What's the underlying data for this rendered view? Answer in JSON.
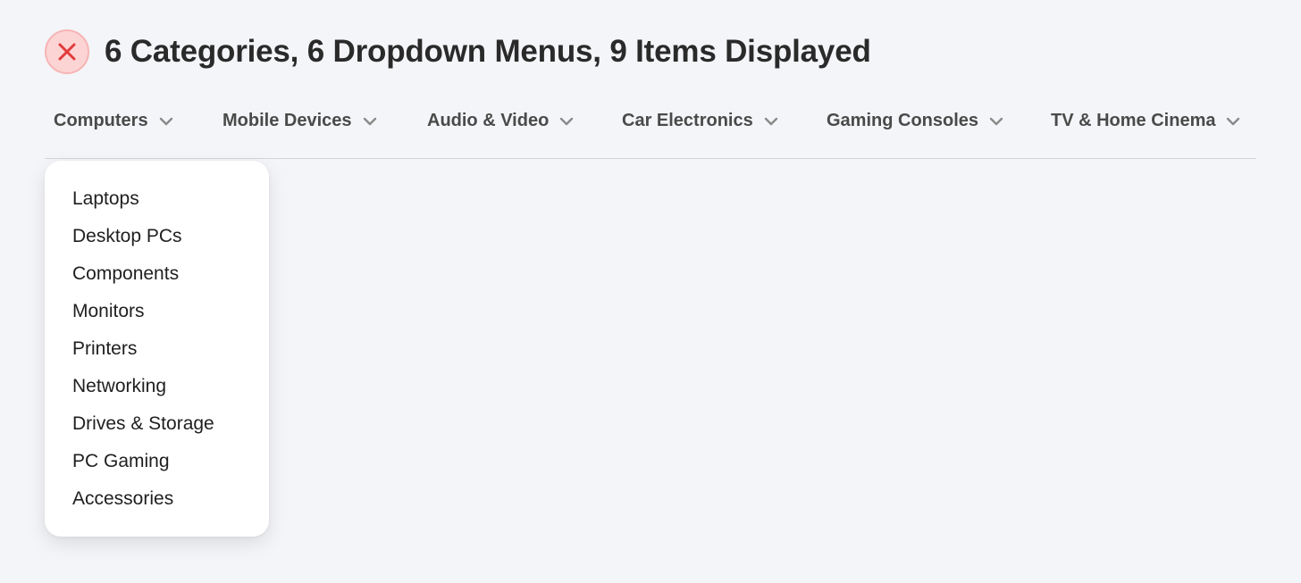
{
  "header": {
    "status_icon": "close-icon",
    "status_color": "#e23b3b",
    "title": "6 Categories, 6 Dropdown Menus, 9 Items Displayed"
  },
  "nav": {
    "items": [
      {
        "label": "Computers",
        "icon": "chevron-down-icon"
      },
      {
        "label": "Mobile Devices",
        "icon": "chevron-down-icon"
      },
      {
        "label": "Audio & Video",
        "icon": "chevron-down-icon"
      },
      {
        "label": "Car Electronics",
        "icon": "chevron-down-icon"
      },
      {
        "label": "Gaming Consoles",
        "icon": "chevron-down-icon"
      },
      {
        "label": "TV & Home Cinema",
        "icon": "chevron-down-icon"
      }
    ],
    "open_item": "Computers"
  },
  "dropdown": {
    "items": [
      "Laptops",
      "Desktop PCs",
      "Components",
      "Monitors",
      "Printers",
      "Networking",
      "Drives & Storage",
      "PC Gaming",
      "Accessories"
    ]
  }
}
